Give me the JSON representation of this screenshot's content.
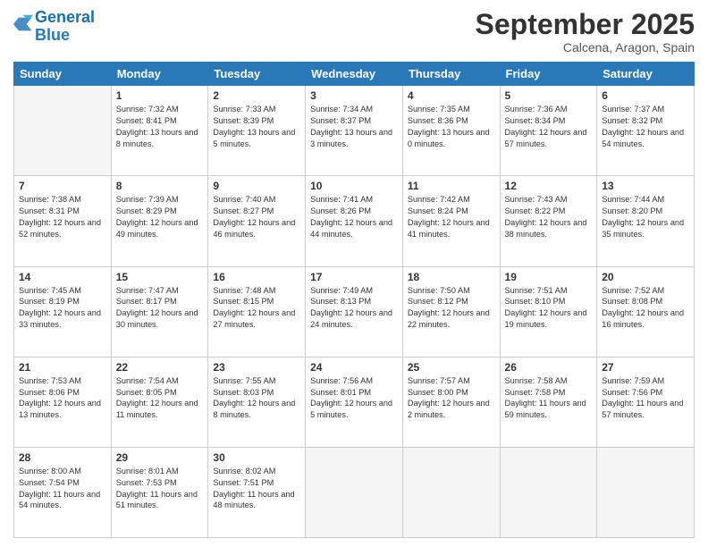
{
  "header": {
    "logo_line1": "General",
    "logo_line2": "Blue",
    "month_title": "September 2025",
    "location": "Calcena, Aragon, Spain"
  },
  "weekdays": [
    "Sunday",
    "Monday",
    "Tuesday",
    "Wednesday",
    "Thursday",
    "Friday",
    "Saturday"
  ],
  "weeks": [
    [
      {
        "day": "",
        "sunrise": "",
        "sunset": "",
        "daylight": ""
      },
      {
        "day": "1",
        "sunrise": "Sunrise: 7:32 AM",
        "sunset": "Sunset: 8:41 PM",
        "daylight": "Daylight: 13 hours and 8 minutes."
      },
      {
        "day": "2",
        "sunrise": "Sunrise: 7:33 AM",
        "sunset": "Sunset: 8:39 PM",
        "daylight": "Daylight: 13 hours and 5 minutes."
      },
      {
        "day": "3",
        "sunrise": "Sunrise: 7:34 AM",
        "sunset": "Sunset: 8:37 PM",
        "daylight": "Daylight: 13 hours and 3 minutes."
      },
      {
        "day": "4",
        "sunrise": "Sunrise: 7:35 AM",
        "sunset": "Sunset: 8:36 PM",
        "daylight": "Daylight: 13 hours and 0 minutes."
      },
      {
        "day": "5",
        "sunrise": "Sunrise: 7:36 AM",
        "sunset": "Sunset: 8:34 PM",
        "daylight": "Daylight: 12 hours and 57 minutes."
      },
      {
        "day": "6",
        "sunrise": "Sunrise: 7:37 AM",
        "sunset": "Sunset: 8:32 PM",
        "daylight": "Daylight: 12 hours and 54 minutes."
      }
    ],
    [
      {
        "day": "7",
        "sunrise": "Sunrise: 7:38 AM",
        "sunset": "Sunset: 8:31 PM",
        "daylight": "Daylight: 12 hours and 52 minutes."
      },
      {
        "day": "8",
        "sunrise": "Sunrise: 7:39 AM",
        "sunset": "Sunset: 8:29 PM",
        "daylight": "Daylight: 12 hours and 49 minutes."
      },
      {
        "day": "9",
        "sunrise": "Sunrise: 7:40 AM",
        "sunset": "Sunset: 8:27 PM",
        "daylight": "Daylight: 12 hours and 46 minutes."
      },
      {
        "day": "10",
        "sunrise": "Sunrise: 7:41 AM",
        "sunset": "Sunset: 8:26 PM",
        "daylight": "Daylight: 12 hours and 44 minutes."
      },
      {
        "day": "11",
        "sunrise": "Sunrise: 7:42 AM",
        "sunset": "Sunset: 8:24 PM",
        "daylight": "Daylight: 12 hours and 41 minutes."
      },
      {
        "day": "12",
        "sunrise": "Sunrise: 7:43 AM",
        "sunset": "Sunset: 8:22 PM",
        "daylight": "Daylight: 12 hours and 38 minutes."
      },
      {
        "day": "13",
        "sunrise": "Sunrise: 7:44 AM",
        "sunset": "Sunset: 8:20 PM",
        "daylight": "Daylight: 12 hours and 35 minutes."
      }
    ],
    [
      {
        "day": "14",
        "sunrise": "Sunrise: 7:45 AM",
        "sunset": "Sunset: 8:19 PM",
        "daylight": "Daylight: 12 hours and 33 minutes."
      },
      {
        "day": "15",
        "sunrise": "Sunrise: 7:47 AM",
        "sunset": "Sunset: 8:17 PM",
        "daylight": "Daylight: 12 hours and 30 minutes."
      },
      {
        "day": "16",
        "sunrise": "Sunrise: 7:48 AM",
        "sunset": "Sunset: 8:15 PM",
        "daylight": "Daylight: 12 hours and 27 minutes."
      },
      {
        "day": "17",
        "sunrise": "Sunrise: 7:49 AM",
        "sunset": "Sunset: 8:13 PM",
        "daylight": "Daylight: 12 hours and 24 minutes."
      },
      {
        "day": "18",
        "sunrise": "Sunrise: 7:50 AM",
        "sunset": "Sunset: 8:12 PM",
        "daylight": "Daylight: 12 hours and 22 minutes."
      },
      {
        "day": "19",
        "sunrise": "Sunrise: 7:51 AM",
        "sunset": "Sunset: 8:10 PM",
        "daylight": "Daylight: 12 hours and 19 minutes."
      },
      {
        "day": "20",
        "sunrise": "Sunrise: 7:52 AM",
        "sunset": "Sunset: 8:08 PM",
        "daylight": "Daylight: 12 hours and 16 minutes."
      }
    ],
    [
      {
        "day": "21",
        "sunrise": "Sunrise: 7:53 AM",
        "sunset": "Sunset: 8:06 PM",
        "daylight": "Daylight: 12 hours and 13 minutes."
      },
      {
        "day": "22",
        "sunrise": "Sunrise: 7:54 AM",
        "sunset": "Sunset: 8:05 PM",
        "daylight": "Daylight: 12 hours and 11 minutes."
      },
      {
        "day": "23",
        "sunrise": "Sunrise: 7:55 AM",
        "sunset": "Sunset: 8:03 PM",
        "daylight": "Daylight: 12 hours and 8 minutes."
      },
      {
        "day": "24",
        "sunrise": "Sunrise: 7:56 AM",
        "sunset": "Sunset: 8:01 PM",
        "daylight": "Daylight: 12 hours and 5 minutes."
      },
      {
        "day": "25",
        "sunrise": "Sunrise: 7:57 AM",
        "sunset": "Sunset: 8:00 PM",
        "daylight": "Daylight: 12 hours and 2 minutes."
      },
      {
        "day": "26",
        "sunrise": "Sunrise: 7:58 AM",
        "sunset": "Sunset: 7:58 PM",
        "daylight": "Daylight: 11 hours and 59 minutes."
      },
      {
        "day": "27",
        "sunrise": "Sunrise: 7:59 AM",
        "sunset": "Sunset: 7:56 PM",
        "daylight": "Daylight: 11 hours and 57 minutes."
      }
    ],
    [
      {
        "day": "28",
        "sunrise": "Sunrise: 8:00 AM",
        "sunset": "Sunset: 7:54 PM",
        "daylight": "Daylight: 11 hours and 54 minutes."
      },
      {
        "day": "29",
        "sunrise": "Sunrise: 8:01 AM",
        "sunset": "Sunset: 7:53 PM",
        "daylight": "Daylight: 11 hours and 51 minutes."
      },
      {
        "day": "30",
        "sunrise": "Sunrise: 8:02 AM",
        "sunset": "Sunset: 7:51 PM",
        "daylight": "Daylight: 11 hours and 48 minutes."
      },
      {
        "day": "",
        "sunrise": "",
        "sunset": "",
        "daylight": ""
      },
      {
        "day": "",
        "sunrise": "",
        "sunset": "",
        "daylight": ""
      },
      {
        "day": "",
        "sunrise": "",
        "sunset": "",
        "daylight": ""
      },
      {
        "day": "",
        "sunrise": "",
        "sunset": "",
        "daylight": ""
      }
    ]
  ]
}
